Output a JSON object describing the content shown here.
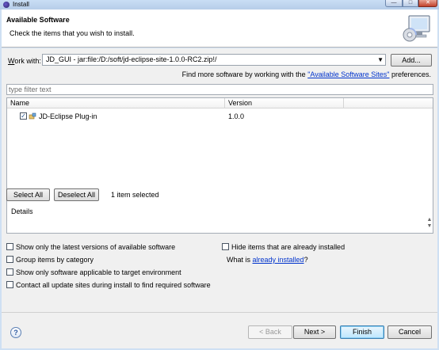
{
  "window": {
    "title": "Install",
    "controls": {
      "minimize": "—",
      "maximize": "□",
      "close": "✕"
    }
  },
  "header": {
    "title": "Available Software",
    "description": "Check the items that you wish to install."
  },
  "work_with": {
    "label_pre": "W",
    "label_rest": "ork with:",
    "value": "JD_GUI - jar:file:/D:/soft/jd-eclipse-site-1.0.0-RC2.zip!/",
    "add_label": "Add...",
    "find_more_pre": "Find more software by working with the ",
    "find_more_link": "\"Available Software Sites\"",
    "find_more_post": " preferences."
  },
  "filter": {
    "placeholder": "type filter text"
  },
  "table": {
    "columns": {
      "name": "Name",
      "version": "Version"
    },
    "rows": [
      {
        "name": "JD-Eclipse Plug-in",
        "version": "1.0.0",
        "checked": true
      }
    ]
  },
  "selection": {
    "select_all": "Select All",
    "deselect_all": "Deselect All",
    "count": "1 item selected"
  },
  "details": {
    "label": "Details"
  },
  "options": {
    "latest_versions": "Show only the latest versions of available software",
    "group_by_category": "Group items by category",
    "applicable_only": "Show only software applicable to target environment",
    "contact_sites": "Contact all update sites during install to find required software",
    "hide_installed": "Hide items that are already installed",
    "what_is_pre": "What is ",
    "what_is_link": "already installed",
    "what_is_post": "?"
  },
  "footer": {
    "help": "?",
    "back": "< Back",
    "next": "Next >",
    "finish": "Finish",
    "cancel": "Cancel"
  },
  "icons": {
    "window": "eclipse-icon",
    "wizard": "install-wizard-icon",
    "plugin": "plugin-icon",
    "help": "help-icon"
  }
}
